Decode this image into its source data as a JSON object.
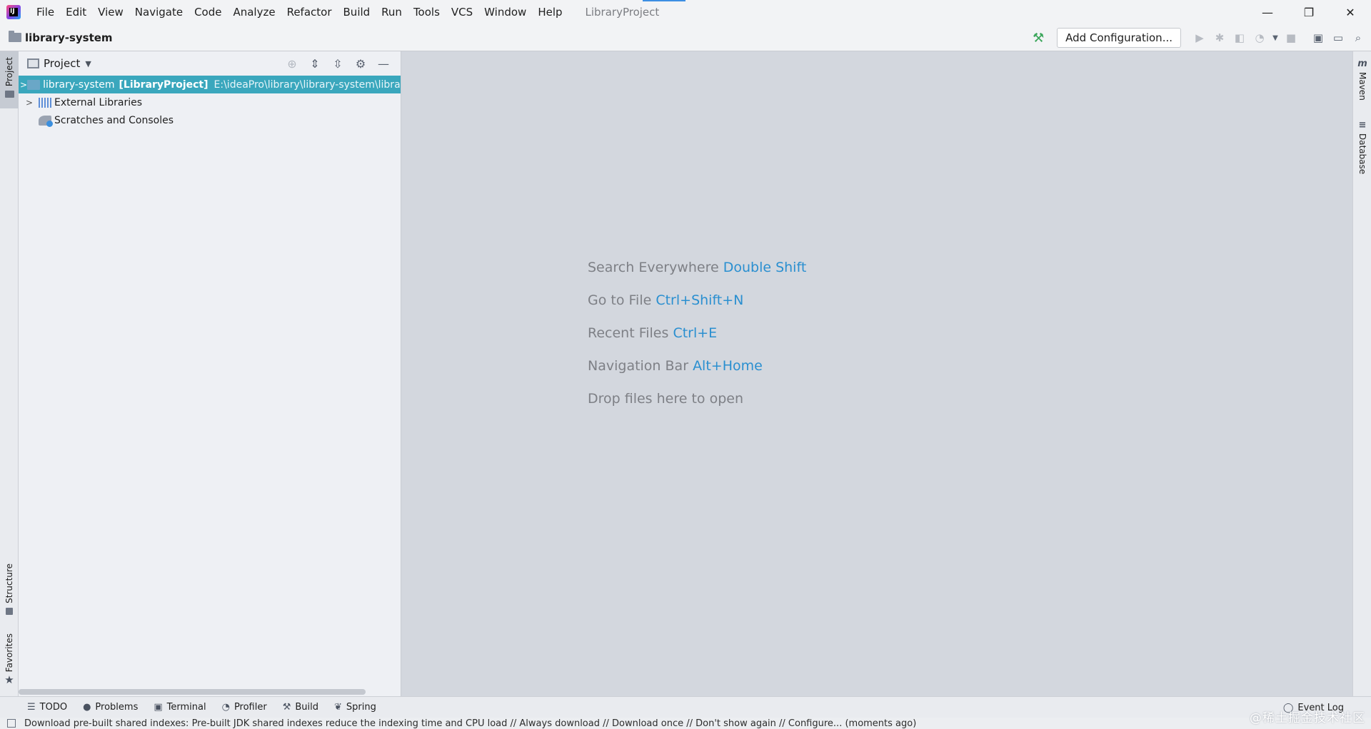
{
  "menubar": {
    "items": [
      "File",
      "Edit",
      "View",
      "Navigate",
      "Code",
      "Analyze",
      "Refactor",
      "Build",
      "Run",
      "Tools",
      "VCS",
      "Window",
      "Help"
    ],
    "project_title": "LibraryProject",
    "window_controls": {
      "minimize": "—",
      "restore": "❐",
      "close": "✕"
    }
  },
  "navbar": {
    "breadcrumb": "library-system",
    "add_configuration": "Add Configuration..."
  },
  "left_tabs": {
    "project": "Project",
    "structure": "Structure",
    "favorites": "Favorites"
  },
  "right_tabs": {
    "maven": "Maven",
    "database": "Database"
  },
  "project_panel": {
    "title": "Project",
    "tree": [
      {
        "name": "library-system",
        "bold": "[LibraryProject]",
        "path": "E:\\ideaPro\\library\\library-system\\library-",
        "selected": true
      },
      {
        "name": "External Libraries"
      },
      {
        "name": "Scratches and Consoles"
      }
    ]
  },
  "editor_hints": [
    {
      "text": "Search Everywhere",
      "shortcut": "Double Shift"
    },
    {
      "text": "Go to File",
      "shortcut": "Ctrl+Shift+N"
    },
    {
      "text": "Recent Files",
      "shortcut": "Ctrl+E"
    },
    {
      "text": "Navigation Bar",
      "shortcut": "Alt+Home"
    },
    {
      "text": "Drop files here to open",
      "shortcut": ""
    }
  ],
  "bottom_tabs": [
    "TODO",
    "Problems",
    "Terminal",
    "Profiler",
    "Build",
    "Spring"
  ],
  "event_log": "Event Log",
  "status_bar": {
    "message": "Download pre-built shared indexes: Pre-built JDK shared indexes reduce the indexing time and CPU load // Always download // Download once // Don't show again // Configure... (moments ago)"
  },
  "watermark": "@稀土掘金技术社区",
  "colors": {
    "accent_selection": "#3aa7bd",
    "shortcut_blue": "#2a8fd0",
    "hammer_green": "#3aa55a"
  }
}
